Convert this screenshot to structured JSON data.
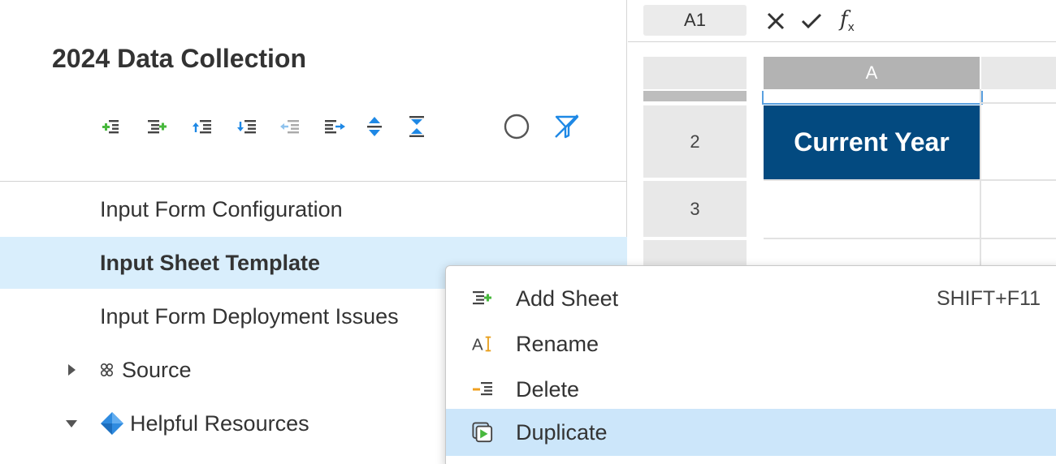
{
  "panel": {
    "title": "2024 Data Collection",
    "toolbar": [
      {
        "name": "add-child-icon"
      },
      {
        "name": "add-sheet-icon"
      },
      {
        "name": "move-up-icon"
      },
      {
        "name": "move-down-icon"
      },
      {
        "name": "outdent-icon"
      },
      {
        "name": "indent-icon"
      },
      {
        "name": "expand-all-icon"
      },
      {
        "name": "collapse-all-icon"
      },
      {
        "name": "circle-status-icon"
      },
      {
        "name": "filter-off-icon"
      }
    ],
    "items": [
      {
        "label": "Input Form Configuration"
      },
      {
        "label": "Input Sheet Template",
        "selected": true
      },
      {
        "label": "Input Form Deployment Issues"
      }
    ],
    "groups": [
      {
        "label": "Source",
        "expanded": false,
        "icon": "link-icon"
      },
      {
        "label": "Helpful Resources",
        "expanded": true,
        "icon": "diamond-icon"
      }
    ]
  },
  "sheet": {
    "name_box": "A1",
    "column_a": "A",
    "rows": [
      {
        "label": "2"
      },
      {
        "label": "3"
      }
    ],
    "cell_a2": "Current Year",
    "colors": {
      "header_cell": "#034a80",
      "selection": "#5aa0e0"
    }
  },
  "context_menu": {
    "items": [
      {
        "label": "Add Sheet",
        "shortcut": "SHIFT+F11",
        "icon": "add-sheet-icon"
      },
      {
        "label": "Rename",
        "shortcut": "",
        "icon": "rename-icon"
      },
      {
        "label": "Delete",
        "shortcut": "",
        "icon": "delete-icon"
      },
      {
        "label": "Duplicate",
        "shortcut": "",
        "icon": "duplicate-icon",
        "highlighted": true
      }
    ]
  },
  "colors": {
    "accent_green": "#48b83d",
    "accent_blue": "#1e88e5",
    "selected_row": "#d9eefc",
    "menu_highlight": "#cce6fa"
  }
}
